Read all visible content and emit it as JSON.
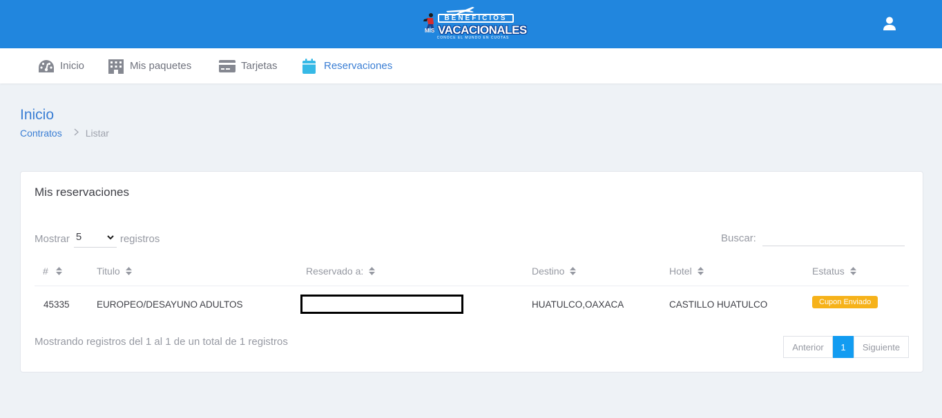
{
  "brand": {
    "line1": "BENEFICIOS",
    "mis": "MIS",
    "line2": "VACACIONALES",
    "tagline": "CONOCE EL MUNDO EN CUOTAS"
  },
  "nav": {
    "items": [
      {
        "label": "Inicio",
        "icon": "dashboard-icon"
      },
      {
        "label": "Mis paquetes",
        "icon": "building-icon"
      },
      {
        "label": "Tarjetas",
        "icon": "credit-card-icon"
      },
      {
        "label": "Reservaciones",
        "icon": "calendar-icon",
        "active": true
      }
    ]
  },
  "page": {
    "title": "Inicio",
    "breadcrumb": [
      "Contratos",
      "Listar"
    ]
  },
  "card": {
    "title": "Mis reservaciones",
    "length_label_before": "Mostrar",
    "length_value": "5",
    "length_label_after": "registros",
    "search_label": "Buscar:",
    "search_value": "",
    "columns": [
      "#",
      "Titulo",
      "Reservado a:",
      "Destino",
      "Hotel",
      "Estatus"
    ],
    "rows": [
      {
        "id": "45335",
        "titulo": "EUROPEO/DESAYUNO ADULTOS",
        "reservado": "",
        "destino": "HUATULCO,OAXACA",
        "hotel": "CASTILLO HUATULCO",
        "estatus": "Cupon Enviado"
      }
    ],
    "info": "Mostrando registros del 1 al 1 de un total de 1 registros",
    "pager": {
      "prev": "Anterior",
      "current": "1",
      "next": "Siguiente"
    }
  },
  "colors": {
    "header": "#2186de",
    "accent": "#3a7ed4",
    "badge": "#f6b21a",
    "page_current": "#129cf1"
  }
}
